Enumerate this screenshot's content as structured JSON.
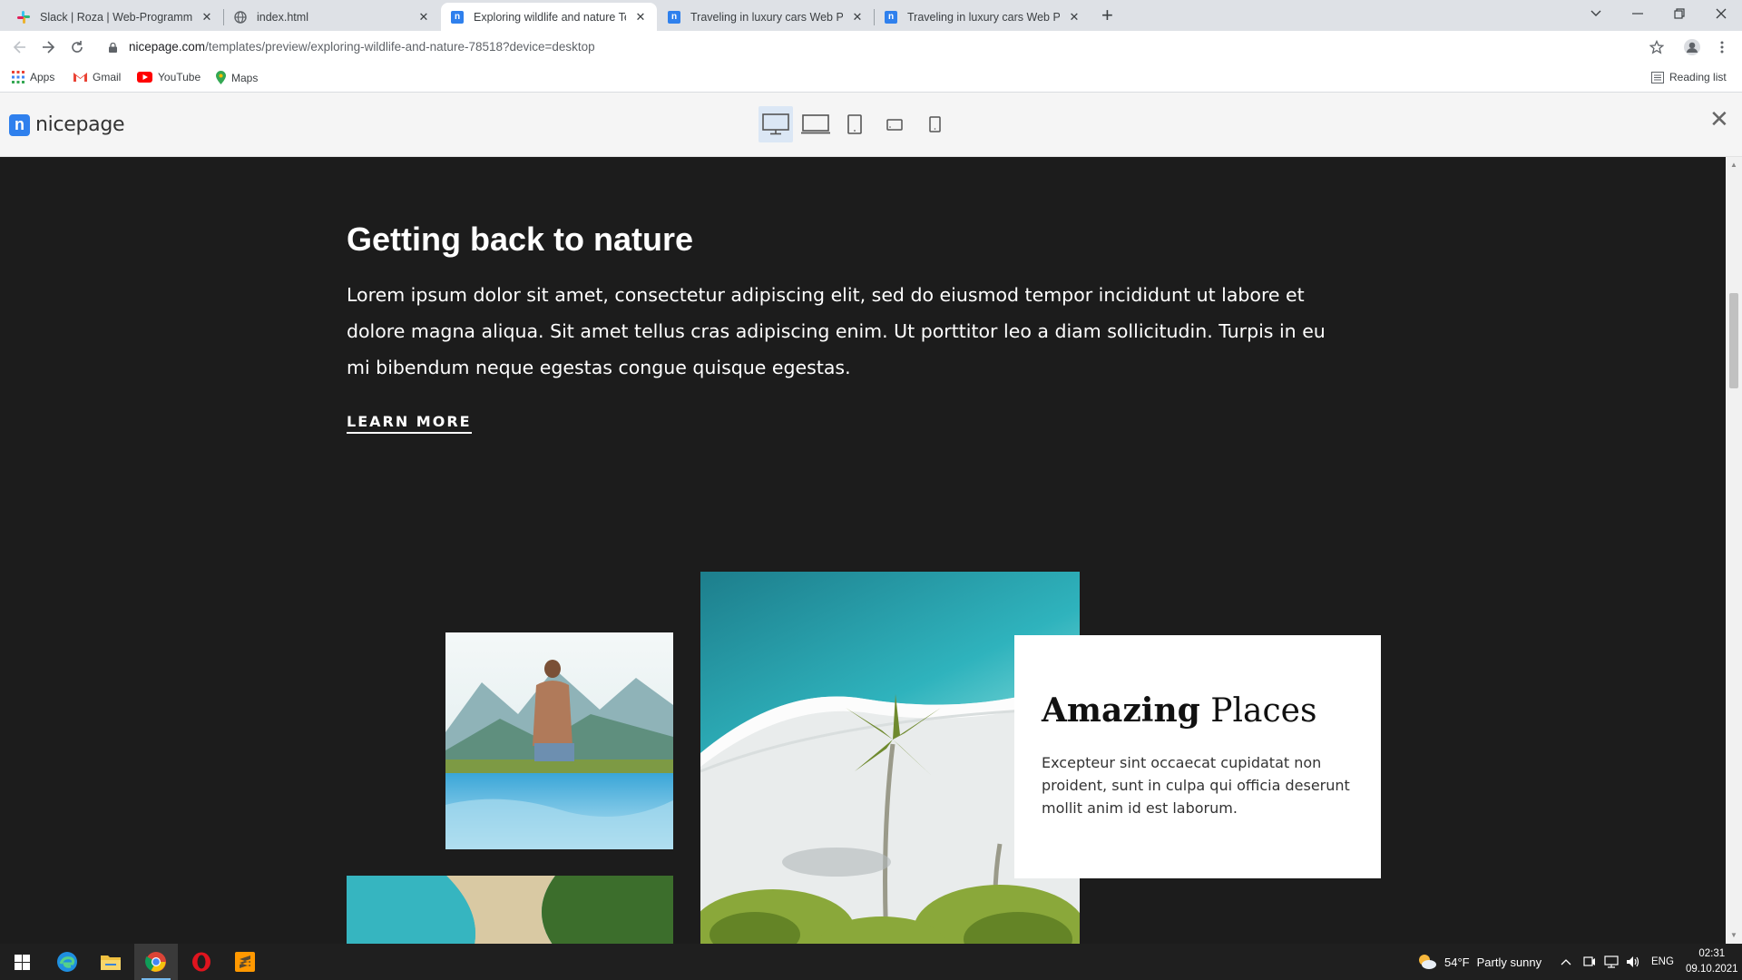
{
  "browser": {
    "tabs": [
      {
        "title": "Slack | Roza | Web-Programming",
        "icon": "slack-icon",
        "active": false
      },
      {
        "title": "index.html",
        "icon": "globe-icon",
        "active": false
      },
      {
        "title": "Exploring wildlife and nature Tem",
        "icon": "nicepage-icon",
        "active": true
      },
      {
        "title": "Traveling in luxury cars Web Page",
        "icon": "nicepage-icon",
        "active": false
      },
      {
        "title": "Traveling in luxury cars Web Page",
        "icon": "nicepage-icon",
        "active": false
      }
    ],
    "new_tab": "+",
    "url_host": "nicepage.com",
    "url_path": "/templates/preview/exploring-wildlife-and-nature-78518?device=desktop",
    "bookmarks": [
      {
        "label": "Apps",
        "icon": "apps-grid-icon"
      },
      {
        "label": "Gmail",
        "icon": "gmail-icon"
      },
      {
        "label": "YouTube",
        "icon": "youtube-icon"
      },
      {
        "label": "Maps",
        "icon": "maps-pin-icon"
      }
    ],
    "reading_list": "Reading list"
  },
  "nicepage": {
    "logo_text": "nicepage",
    "logo_mark": "n",
    "devices": [
      "desktop-icon",
      "laptop-icon",
      "tablet-icon",
      "phone-landscape-icon",
      "phone-portrait-icon"
    ],
    "active_device": "desktop-icon",
    "close": "✕"
  },
  "page": {
    "heading_light": "Getting back to ",
    "heading_bold": "nature",
    "body": "Lorem ipsum dolor sit amet, consectetur adipiscing elit, sed do eiusmod tempor incididunt ut labore et dolore magna aliqua. Sit amet tellus cras adipiscing enim. Ut porttitor leo a diam sollicitudin. Turpis in eu mi bibendum neque egestas congue quisque egestas.",
    "learn_more": "LEARN MORE",
    "card": {
      "title_bold": "Amazing",
      "title_light": " Places",
      "text": "Excepteur sint occaecat cupidatat non proident, sunt in culpa qui officia deserunt mollit anim id est laborum."
    }
  },
  "taskbar": {
    "weather_temp": "54°F",
    "weather_text": "Partly sunny",
    "language": "ENG",
    "time": "02:31",
    "date": "09.10.2021"
  },
  "colors": {
    "page_bg": "#1c1c1c",
    "nicepage_blue": "#2f80ed",
    "card_bg": "#ffffff"
  }
}
